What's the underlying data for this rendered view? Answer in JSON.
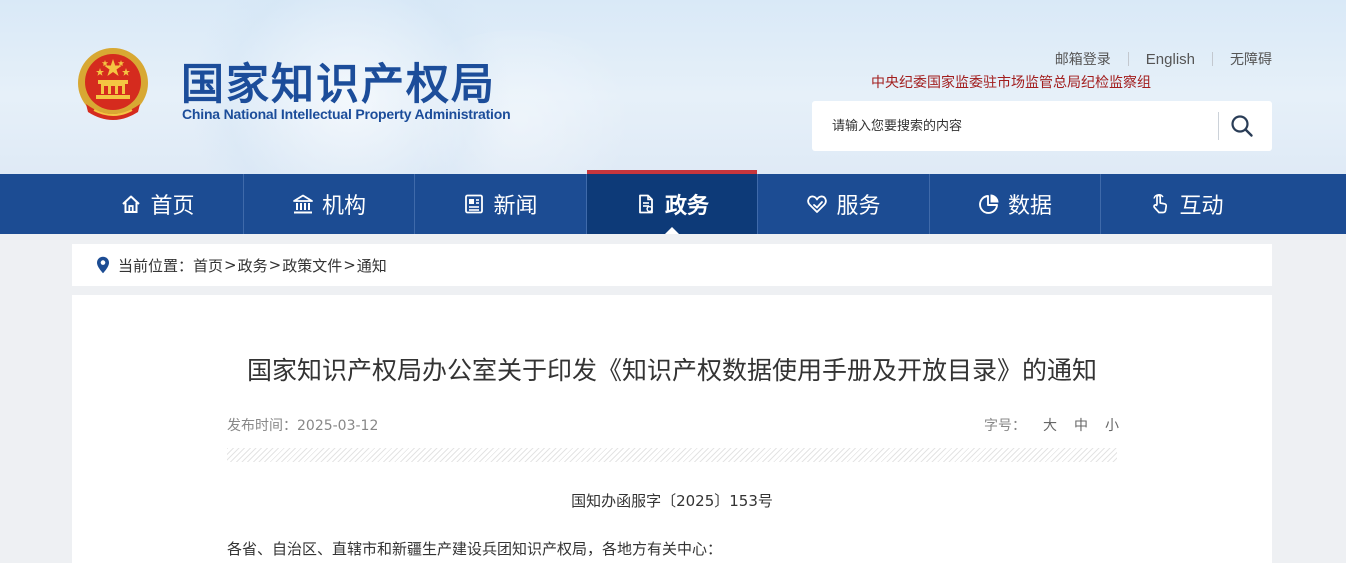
{
  "header": {
    "logo_cn": "国家知识产权局",
    "logo_en": "China National Intellectual Property Administration",
    "top_links": {
      "mail": "邮箱登录",
      "english": "English",
      "accessibility": "无障碍"
    },
    "org_link": "中央纪委国家监委驻市场监管总局纪检监察组",
    "search": {
      "placeholder": "请输入您要搜索的内容"
    }
  },
  "nav": {
    "items": [
      {
        "label": "首页",
        "icon": "home-icon"
      },
      {
        "label": "机构",
        "icon": "institution-icon"
      },
      {
        "label": "新闻",
        "icon": "news-icon"
      },
      {
        "label": "政务",
        "icon": "document-icon",
        "active": true
      },
      {
        "label": "服务",
        "icon": "heart-hand-icon"
      },
      {
        "label": "数据",
        "icon": "pie-chart-icon"
      },
      {
        "label": "互动",
        "icon": "hand-pointer-icon"
      }
    ]
  },
  "breadcrumb": {
    "prefix": "当前位置：",
    "items": [
      "首页",
      "政务",
      "政策文件",
      "通知"
    ],
    "separator": ">"
  },
  "article": {
    "title": "国家知识产权局办公室关于印发《知识产权数据使用手册及开放目录》的通知",
    "publish_label": "发布时间：",
    "publish_date": "2025-03-12",
    "font_size_label": "字号：",
    "font_sizes": [
      "大",
      "中",
      "小"
    ],
    "doc_number": "国知办函服字〔2025〕153号",
    "salutation": "各省、自治区、直辖市和新疆生产建设兵团知识产权局，各地方有关中心："
  },
  "colors": {
    "nav_bg": "#1c4c93",
    "nav_active_bg": "#0d3a78",
    "nav_active_bar": "#c6363d",
    "brand_blue": "#1c4d9a",
    "org_link_red": "#a21d1d"
  }
}
